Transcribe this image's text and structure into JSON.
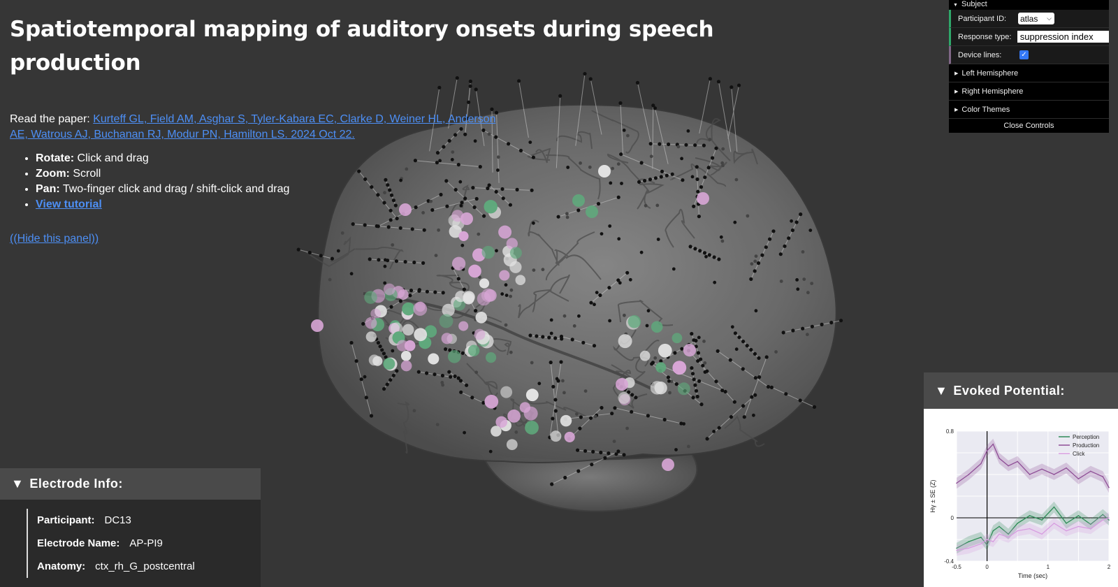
{
  "header": {
    "title": "Spatiotemporal mapping of auditory onsets during speech production"
  },
  "paper": {
    "prefix": "Read the paper: ",
    "citation": "Kurteff GL, Field AM, Asghar S, Tyler-Kabara EC, Clarke D, Weiner HL, Anderson AE, Watrous AJ, Buchanan RJ, Modur PN, Hamilton LS. 2024 Oct 22."
  },
  "instructions": [
    {
      "label": "Rotate:",
      "text": " Click and drag"
    },
    {
      "label": "Zoom:",
      "text": " Scroll"
    },
    {
      "label": "Pan:",
      "text": " Two-finger click and drag / shift-click and drag"
    }
  ],
  "tutorial_link": "View tutorial",
  "hide_panel_link": "((Hide this panel))",
  "controls": {
    "folder_title": "Subject",
    "participant_label": "Participant ID:",
    "participant_value": "atlas",
    "response_label": "Response type:",
    "response_value": "suppression index",
    "device_lines_label": "Device lines:",
    "device_lines_checked": true,
    "folders": [
      "Left Hemisphere",
      "Right Hemisphere",
      "Color Themes"
    ],
    "close_label": "Close Controls"
  },
  "electrode_info": {
    "title": "Electrode Info:",
    "participant_label": "Participant:",
    "participant_value": "DC13",
    "electrode_label": "Electrode Name:",
    "electrode_value": "AP-PI9",
    "anatomy_label": "Anatomy:",
    "anatomy_value": "ctx_rh_G_postcentral"
  },
  "evoked": {
    "title": "Evoked Potential:"
  },
  "chart_data": {
    "type": "line",
    "xlabel": "Time (sec)",
    "ylabel": "Hγ ± SE (Z)",
    "xlim": [
      -0.5,
      2
    ],
    "ylim": [
      -0.4,
      0.8
    ],
    "xticks": [
      "-0.5",
      "0",
      "1",
      "2"
    ],
    "yticks": [
      "0.8",
      "0",
      "-0.4"
    ],
    "legend_position": "top-right",
    "x": [
      -0.5,
      -0.3,
      -0.1,
      0.0,
      0.1,
      0.2,
      0.35,
      0.5,
      0.7,
      0.9,
      1.1,
      1.3,
      1.5,
      1.7,
      1.9,
      2.0
    ],
    "series": [
      {
        "name": "Perception",
        "color": "#2e8b57",
        "values": [
          -0.28,
          -0.22,
          -0.18,
          -0.25,
          -0.12,
          -0.08,
          -0.15,
          -0.05,
          0.02,
          -0.02,
          0.1,
          -0.05,
          0.02,
          -0.06,
          0.03,
          -0.02
        ]
      },
      {
        "name": "Production",
        "color": "#8e4e96",
        "values": [
          0.32,
          0.4,
          0.5,
          0.62,
          0.68,
          0.55,
          0.48,
          0.52,
          0.4,
          0.45,
          0.4,
          0.46,
          0.36,
          0.43,
          0.38,
          0.28
        ]
      },
      {
        "name": "Click",
        "color": "#d79de0",
        "values": [
          -0.3,
          -0.28,
          -0.24,
          -0.2,
          -0.22,
          -0.15,
          -0.18,
          -0.12,
          -0.1,
          -0.15,
          -0.05,
          -0.12,
          -0.08,
          -0.1,
          -0.02,
          0.0
        ]
      }
    ]
  },
  "colors": {
    "accent_link": "#4d8ff5",
    "green_electrode": "#5fa97c",
    "pink_electrode": "#d8a6d6"
  }
}
